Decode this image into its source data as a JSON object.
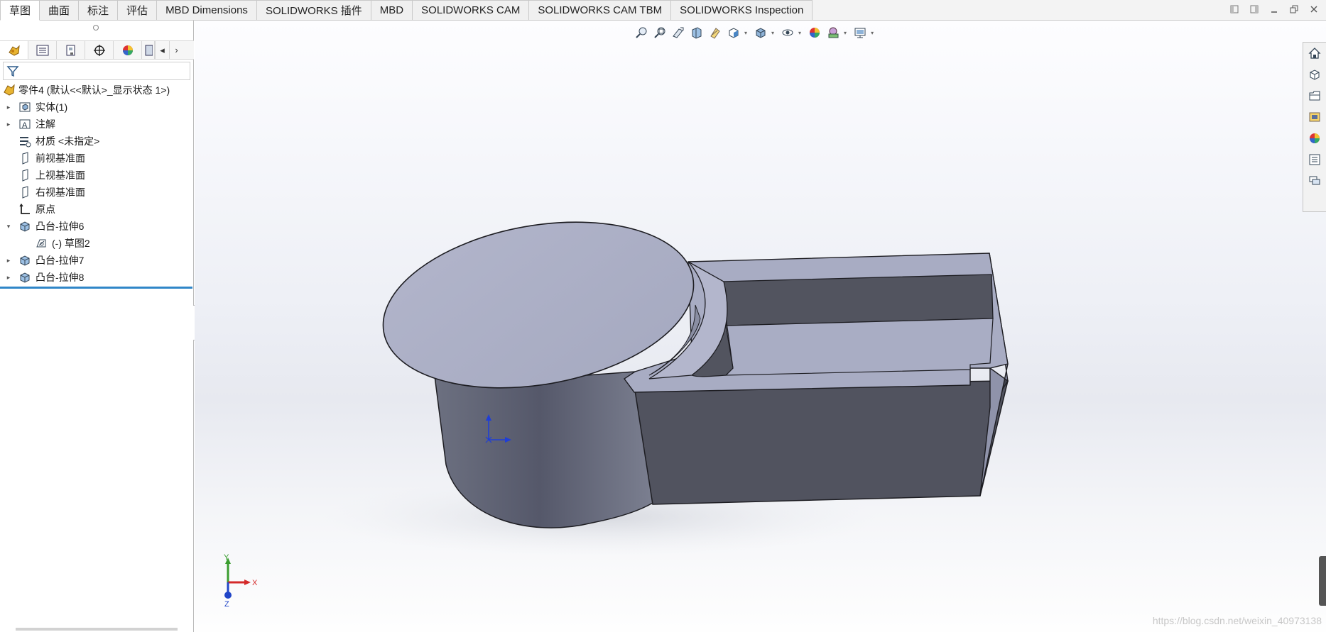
{
  "tabs": [
    {
      "label": "草图",
      "active": true
    },
    {
      "label": "曲面",
      "active": false
    },
    {
      "label": "标注",
      "active": false
    },
    {
      "label": "评估",
      "active": false
    },
    {
      "label": "MBD Dimensions",
      "active": false
    },
    {
      "label": "SOLIDWORKS 插件",
      "active": false
    },
    {
      "label": "MBD",
      "active": false
    },
    {
      "label": "SOLIDWORKS CAM",
      "active": false
    },
    {
      "label": "SOLIDWORKS CAM TBM",
      "active": false
    },
    {
      "label": "SOLIDWORKS Inspection",
      "active": false
    }
  ],
  "feature_tree": {
    "root": "零件4 (默认<<默认>_显示状态 1>)",
    "items": [
      {
        "label": "实体(1)",
        "icon": "solid-bodies-icon"
      },
      {
        "label": "注解",
        "icon": "annotations-icon"
      },
      {
        "label": "材质 <未指定>",
        "icon": "material-icon"
      },
      {
        "label": "前视基准面",
        "icon": "plane-icon"
      },
      {
        "label": "上视基准面",
        "icon": "plane-icon"
      },
      {
        "label": "右视基准面",
        "icon": "plane-icon"
      },
      {
        "label": "原点",
        "icon": "origin-icon"
      },
      {
        "label": "凸台-拉伸6",
        "icon": "extrude-icon"
      },
      {
        "label": "(-) 草图2",
        "icon": "sketch-icon"
      },
      {
        "label": "凸台-拉伸7",
        "icon": "extrude-icon"
      },
      {
        "label": "凸台-拉伸8",
        "icon": "extrude-icon"
      }
    ]
  },
  "fm_tabs": [
    "featuremanager-icon",
    "propertymanager-icon",
    "configurationmanager-icon",
    "dimxpert-icon",
    "display-manager-icon",
    "cam-feature-tree-icon"
  ],
  "heads_up_toolbar": [
    "zoom-to-fit-icon",
    "zoom-to-area-icon",
    "previous-view-icon",
    "section-view-icon",
    "dynamic-annotation-icon",
    "view-orientation-icon",
    "display-style-icon",
    "hide-show-items-icon",
    "edit-appearance-icon",
    "apply-scene-icon",
    "view-settings-icon"
  ],
  "task_pane": [
    "solidworks-resources-icon",
    "design-library-icon",
    "file-explorer-icon",
    "view-palette-icon",
    "appearances-icon",
    "custom-properties-icon",
    "forum-icon"
  ],
  "triad": {
    "x": "X",
    "y": "Y",
    "z": "Z"
  },
  "watermark": "https://blog.csdn.net/weixin_40973138",
  "colors": {
    "model_top": "#abafc6",
    "model_side": "#52545f",
    "selection_bar": "#2f86c8"
  }
}
